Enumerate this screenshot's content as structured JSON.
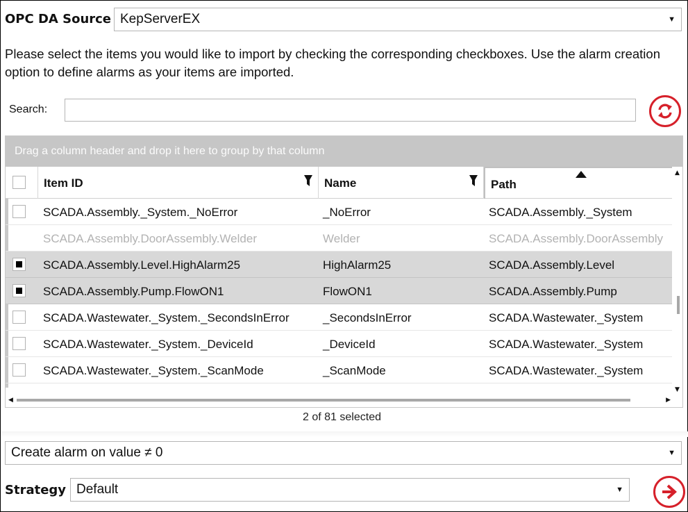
{
  "source": {
    "label": "OPC DA Source",
    "value": "KepServerEX"
  },
  "instructions": "Please select the items you would like to import by checking the corresponding checkboxes. Use the alarm creation option to define alarms as your items are imported.",
  "search": {
    "label": "Search:",
    "value": ""
  },
  "grid": {
    "group_hint": "Drag a column header and drop it here to group by that column",
    "columns": [
      {
        "label": "Item ID"
      },
      {
        "label": "Name"
      },
      {
        "label": "Path"
      }
    ],
    "sort_column": "Path",
    "rows": [
      {
        "id": "SCADA.Assembly._System._NoError",
        "name": "_NoError",
        "path": "SCADA.Assembly._System",
        "checked": false,
        "state": "normal"
      },
      {
        "id": "SCADA.Assembly.DoorAssembly.Welder",
        "name": "Welder",
        "path": "SCADA.Assembly.DoorAssembly",
        "checked": false,
        "state": "disabled"
      },
      {
        "id": "SCADA.Assembly.Level.HighAlarm25",
        "name": "HighAlarm25",
        "path": "SCADA.Assembly.Level",
        "checked": true,
        "state": "selected"
      },
      {
        "id": "SCADA.Assembly.Pump.FlowON1",
        "name": "FlowON1",
        "path": "SCADA.Assembly.Pump",
        "checked": true,
        "state": "selected"
      },
      {
        "id": "SCADA.Wastewater._System._SecondsInError",
        "name": "_SecondsInError",
        "path": "SCADA.Wastewater._System",
        "checked": false,
        "state": "normal"
      },
      {
        "id": "SCADA.Wastewater._System._DeviceId",
        "name": "_DeviceId",
        "path": "SCADA.Wastewater._System",
        "checked": false,
        "state": "normal"
      },
      {
        "id": "SCADA.Wastewater._System._ScanMode",
        "name": "_ScanMode",
        "path": "SCADA.Wastewater._System",
        "checked": false,
        "state": "normal"
      }
    ]
  },
  "selected_count": "2 of 81 selected",
  "alarm": {
    "value": "Create alarm on value ≠ 0"
  },
  "strategy": {
    "label": "Strategy",
    "value": "Default"
  },
  "colors": {
    "accent": "#d6202a",
    "selected_row": "#d8d8d8",
    "group_bar": "#c6c6c6"
  },
  "icons": {
    "refresh": "refresh-icon",
    "next": "arrow-right-icon",
    "filter": "filter-icon",
    "sort": "sort-ascending-icon"
  }
}
